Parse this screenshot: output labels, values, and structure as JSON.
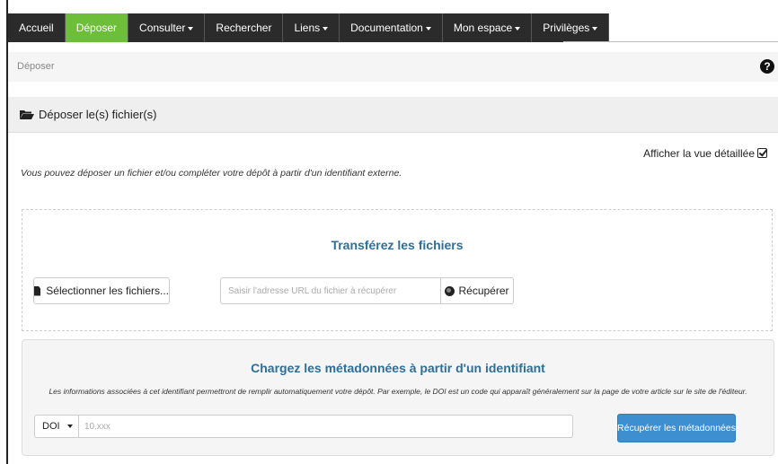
{
  "nav": {
    "items": [
      {
        "label": "Accueil",
        "dropdown": false
      },
      {
        "label": "Déposer",
        "dropdown": false,
        "active": true
      },
      {
        "label": "Consulter",
        "dropdown": true
      },
      {
        "label": "Rechercher",
        "dropdown": false
      },
      {
        "label": "Liens",
        "dropdown": true
      },
      {
        "label": "Documentation",
        "dropdown": true
      },
      {
        "label": "Mon espace",
        "dropdown": true
      },
      {
        "label": "Privilèges",
        "dropdown": true
      }
    ],
    "active_color": "#6dbf3a",
    "bg_color": "#2b2b2b"
  },
  "breadcrumb": {
    "text": "Déposer",
    "help_icon": "question-circle-icon"
  },
  "panel": {
    "title": "Déposer le(s) fichier(s)",
    "icon": "folder-open-icon"
  },
  "detail_link": {
    "label": "Afficher la vue détaillée",
    "icon": "check-square-icon"
  },
  "intro": "Vous pouvez déposer un fichier et/ou compléter votre dépôt à partir d'un identifiant externe.",
  "upload": {
    "title": "Transférez les fichiers",
    "select_label": "Sélectionner les fichiers...",
    "url_placeholder": "Saisir l'adresse URL du fichier à récupérer",
    "fetch_label": "Récupérer"
  },
  "metadata": {
    "title": "Chargez les métadonnées à partir d'un identifiant",
    "description": "Les informations associées à cet identifiant permettront de remplir automatiquement votre dépôt. Par exemple, le DOI est un code qui apparaît généralement sur la page de votre article sur le site de l'éditeur.",
    "id_type": "DOI",
    "id_placeholder": "10.xxx",
    "button_label": "Récupérer les métadonnées",
    "accent_color": "#3d8fd0",
    "title_color": "#2e6e99"
  }
}
